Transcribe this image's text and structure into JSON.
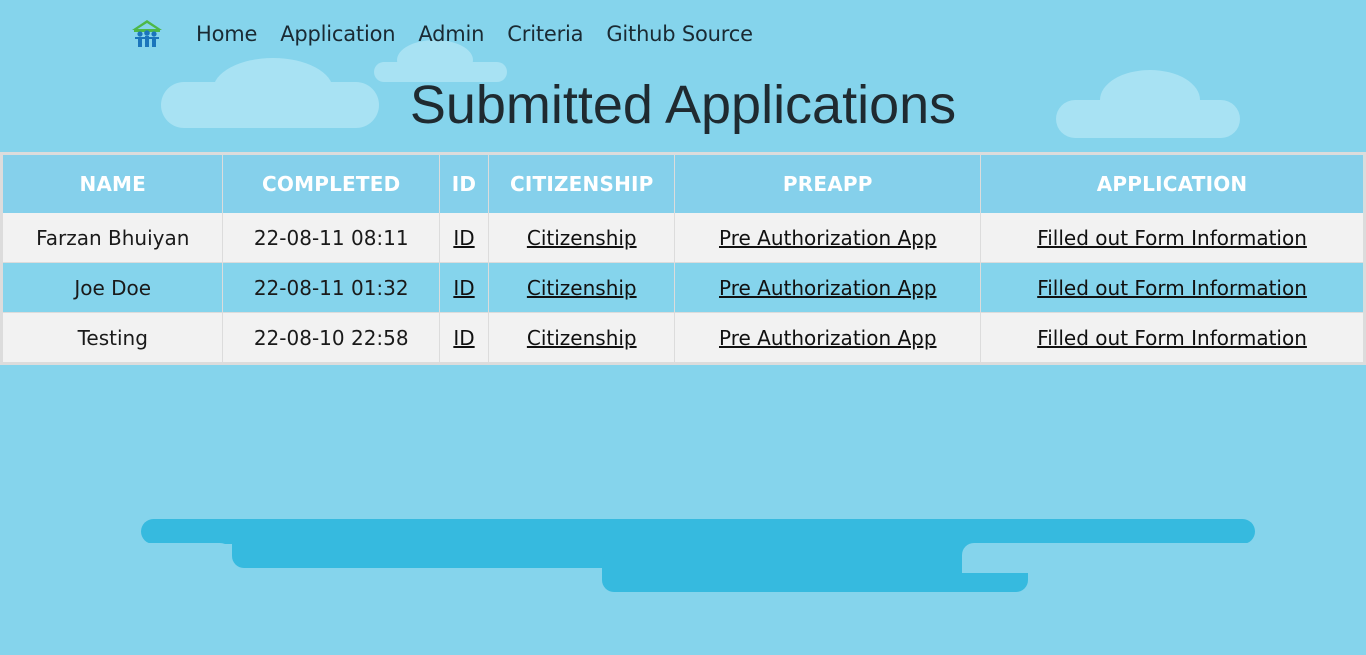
{
  "nav": {
    "logo_icon": "habitat-house-people-icon",
    "links": [
      "Home",
      "Application",
      "Admin",
      "Criteria",
      "Github Source"
    ]
  },
  "page_title": "Submitted Applications",
  "table": {
    "headers": [
      "NAME",
      "COMPLETED",
      "ID",
      "CITIZENSHIP",
      "PREAPP",
      "APPLICATION"
    ],
    "rows": [
      {
        "name": "Farzan Bhuiyan",
        "completed": "22-08-11 08:11",
        "id": "ID",
        "citizenship": "Citizenship",
        "preapp": "Pre Authorization App",
        "application": "Filled out Form Information"
      },
      {
        "name": "Joe Doe",
        "completed": "22-08-11 01:32",
        "id": "ID",
        "citizenship": "Citizenship",
        "preapp": "Pre Authorization App",
        "application": "Filled out Form Information"
      },
      {
        "name": "Testing",
        "completed": "22-08-10 22:58",
        "id": "ID",
        "citizenship": "Citizenship",
        "preapp": "Pre Authorization App",
        "application": "Filled out Form Information"
      }
    ]
  },
  "colors": {
    "background": "#85d4ec",
    "header_bg": "#85d0eb",
    "row_light": "#f2f2f2",
    "cloud": "#a8e2f3",
    "accent_shape": "#36badf"
  }
}
